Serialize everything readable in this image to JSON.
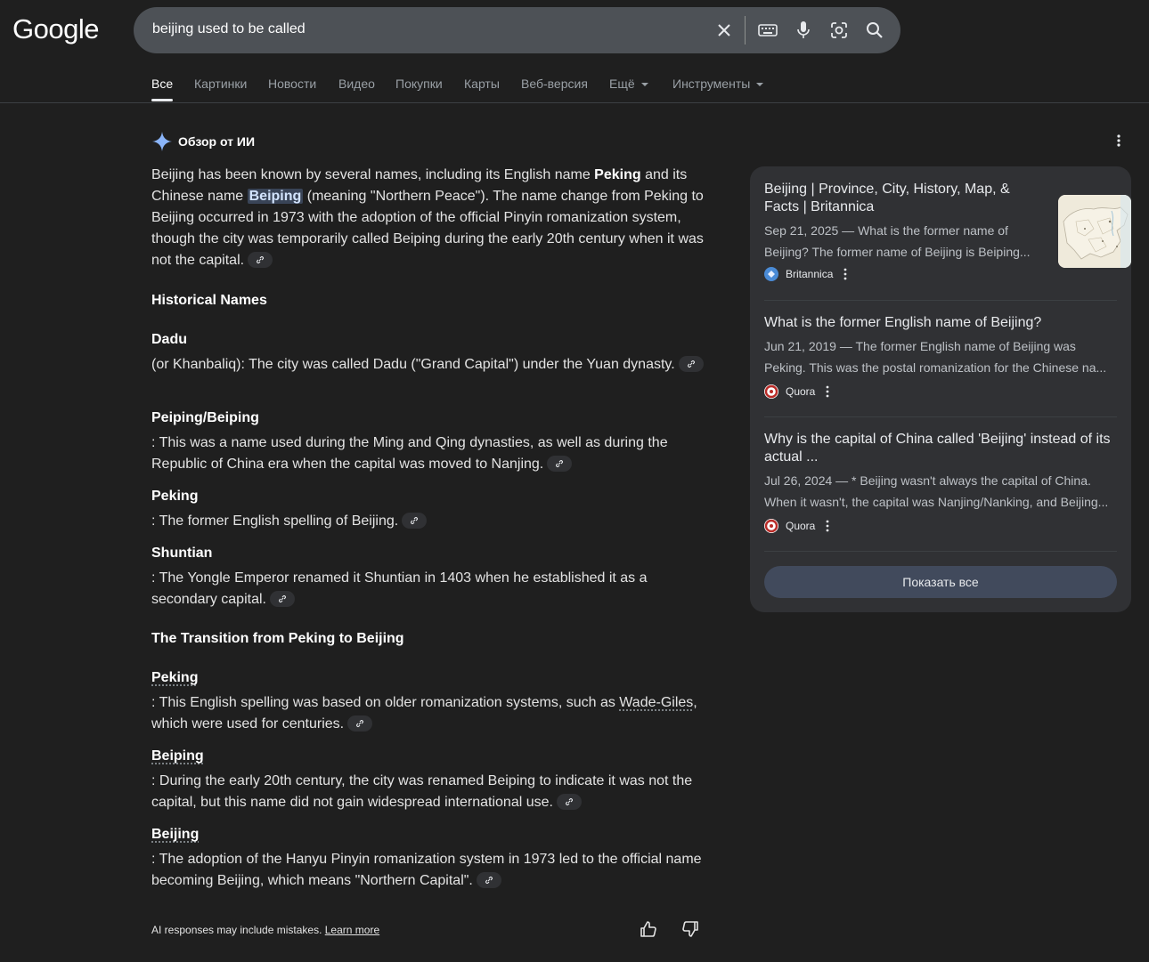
{
  "header": {
    "logo": "Google",
    "query": "beijing used to be called"
  },
  "tabs": [
    {
      "label": "Все",
      "active": true
    },
    {
      "label": "Картинки"
    },
    {
      "label": "Новости"
    },
    {
      "label": "Видео"
    },
    {
      "label": "Покупки"
    },
    {
      "label": "Карты"
    },
    {
      "label": "Веб-версия"
    },
    {
      "label": "Ещё"
    },
    {
      "label": "Инструменты"
    }
  ],
  "ai": {
    "title": "Обзор от ИИ",
    "intro": {
      "p1": "Beijing has been known by several names, including its English name ",
      "b1": "Peking",
      "p2": " and its Chinese name ",
      "hl": "Beiping",
      "p3": " (meaning \"Northern Peace\"). The name change from Peking to Beijing occurred in 1973 with the adoption of the official Pinyin romanization system, though the city was temporarily called Beiping during the early 20th century when it was not the capital."
    },
    "section1": "Historical Names",
    "names": [
      {
        "name": "Dadu",
        "desc": "(or Khanbaliq): The city was called Dadu (\"Grand Capital\") under the Yuan dynasty."
      },
      {
        "name": "Peiping/Beiping",
        "desc": ": This was a name used during the Ming and Qing dynasties, as well as during the Republic of China era when the capital was moved to Nanjing."
      },
      {
        "name": "Peking",
        "desc": ": The former English spelling of Beijing."
      },
      {
        "name": "Shuntian",
        "desc": ": The Yongle Emperor renamed it Shuntian in 1403 when he established it as a secondary capital."
      }
    ],
    "section2": "The Transition from Peking to Beijing",
    "transition": [
      {
        "name": "Peking",
        "desc_a": ": This English spelling was based on older romanization systems, such as ",
        "link": "Wade-Giles",
        "desc_b": ", which were used for centuries."
      },
      {
        "name": "Beiping",
        "desc_a": ": During the early 20th century, the city was renamed Beiping to indicate it was not the capital, but this name did not gain widespread international use."
      },
      {
        "name": "Beijing",
        "desc_a": ": The adoption of the Hanyu Pinyin romanization system in 1973 led to the official name becoming Beijing, which means \"Northern Capital\"."
      }
    ],
    "footer": "AI responses may include mistakes. ",
    "learn_more": "Learn more"
  },
  "sources": [
    {
      "title": "Beijing | Province, City, History, Map, & Facts | Britannica",
      "snippet1": "Sep 21, 2025 — What is the former name of",
      "snippet2": "Beijing? The former name of Beijing is Beiping...",
      "site": "Britannica"
    },
    {
      "title": "What is the former English name of Beijing?",
      "snippet1": "Jun 21, 2019 — The former English name of Beijing was",
      "snippet2": "Peking. This was the postal romanization for the Chinese na...",
      "site": "Quora"
    },
    {
      "title": "Why is the capital of China called 'Beijing' instead of its actual ...",
      "snippet1": "Jul 26, 2024 — * Beijing wasn't always the capital of China.",
      "snippet2": "When it wasn't, the capital was Nanjing/Nanking, and Beijing...",
      "site": "Quora"
    }
  ],
  "show_all": "Показать все",
  "colors": {
    "background": "#1f1f1f",
    "searchbar": "#4d5156",
    "panel": "#303134",
    "highlight": "#394457",
    "quora": "#b92b27"
  }
}
